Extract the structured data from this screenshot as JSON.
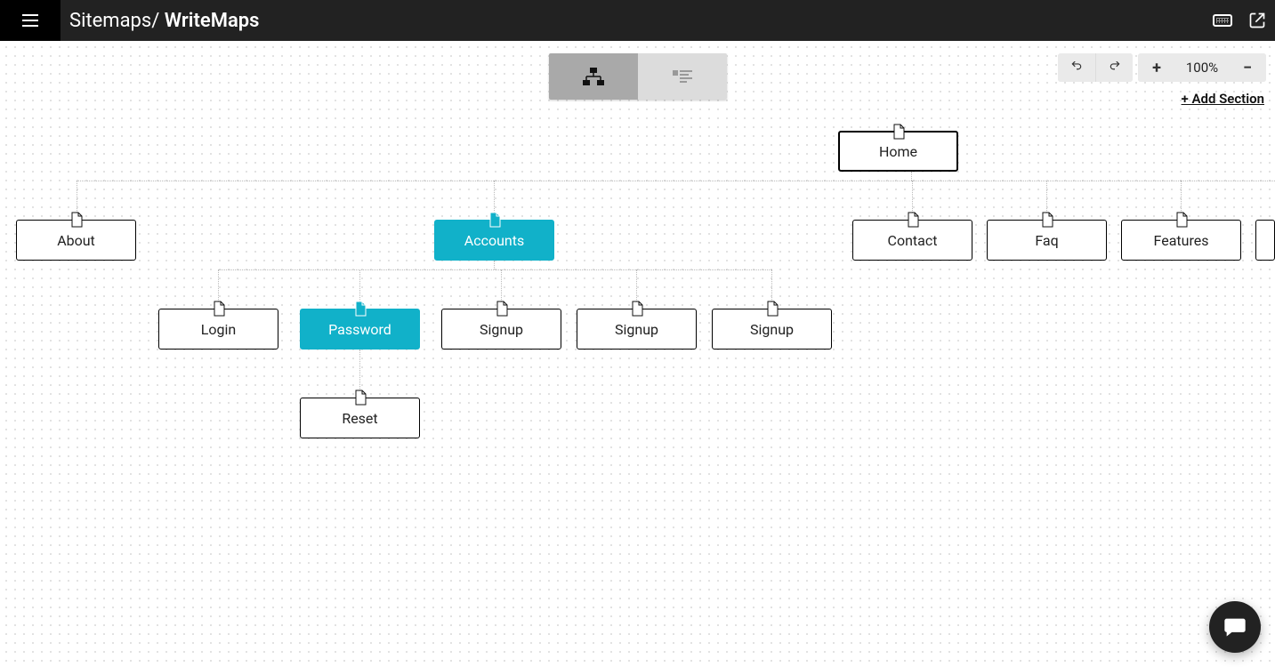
{
  "header": {
    "breadcrumb_prefix": "Sitemaps/ ",
    "breadcrumb_current": "WriteMaps"
  },
  "toolbar": {
    "zoom_label": "100%",
    "add_section_label": "+ Add Section"
  },
  "view_toggle": {
    "tree_active": true,
    "list_active": false
  },
  "nodes": {
    "home": {
      "label": "Home"
    },
    "about": {
      "label": "About"
    },
    "accounts": {
      "label": "Accounts"
    },
    "contact": {
      "label": "Contact"
    },
    "faq": {
      "label": "Faq"
    },
    "features": {
      "label": "Features"
    },
    "login": {
      "label": "Login"
    },
    "password": {
      "label": "Password"
    },
    "signup1": {
      "label": "Signup"
    },
    "signup2": {
      "label": "Signup"
    },
    "signup3": {
      "label": "Signup"
    },
    "reset": {
      "label": "Reset"
    }
  },
  "colors": {
    "accent": "#11b1c9",
    "header": "#222222"
  }
}
